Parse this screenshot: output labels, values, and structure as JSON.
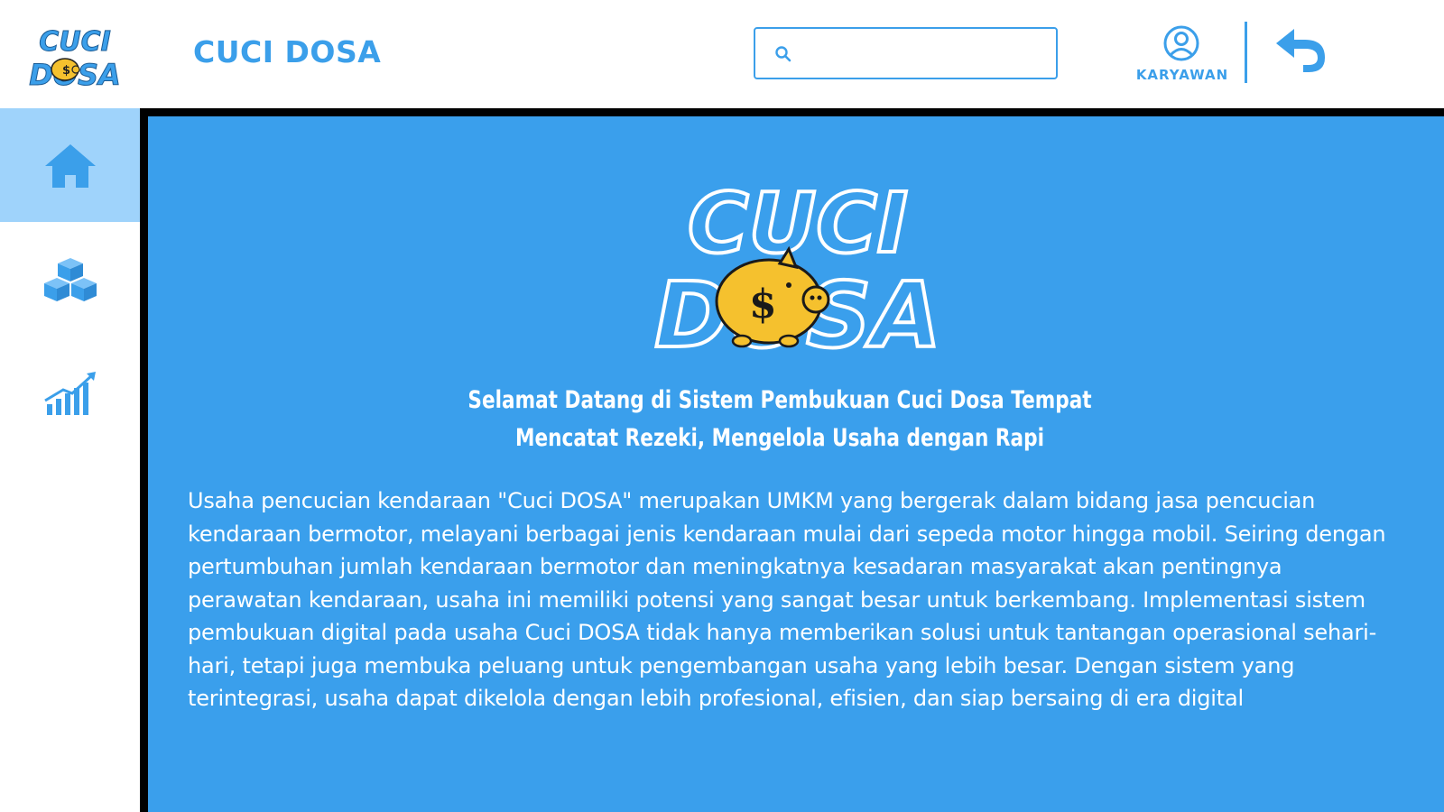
{
  "header": {
    "logo_text": [
      "CUCI",
      "DOSA"
    ],
    "app_title": "CUCI DOSA",
    "search": {
      "value": "",
      "placeholder": "",
      "icon": "search-icon"
    },
    "user": {
      "label": "KARYAWAN",
      "icon": "user-circle-icon"
    },
    "back_icon": "undo-arrow-icon"
  },
  "sidebar": {
    "items": [
      {
        "icon": "home-icon",
        "active": true
      },
      {
        "icon": "boxes-icon",
        "active": false
      },
      {
        "icon": "growth-chart-icon",
        "active": false
      }
    ]
  },
  "main": {
    "logo_text": [
      "CUCI",
      "DOSA"
    ],
    "welcome_line1": "Selamat Datang di Sistem Pembukuan Cuci Dosa Tempat",
    "welcome_line2": "Mencatat Rezeki, Mengelola Usaha dengan Rapi",
    "description": "Usaha pencucian kendaraan \"Cuci DOSA\"  merupakan UMKM yang bergerak dalam bidang jasa pencucian kendaraan bermotor, melayani berbagai jenis kendaraan mulai dari sepeda motor hingga mobil. Seiring dengan pertumbuhan jumlah kendaraan bermotor dan meningkatnya kesadaran masyarakat akan pentingnya perawatan kendaraan, usaha ini memiliki potensi yang sangat besar untuk berkembang. Implementasi sistem pembukuan digital pada usaha Cuci DOSA tidak hanya memberikan solusi untuk tantangan operasional sehari-hari, tetapi juga membuka peluang untuk pengembangan usaha yang lebih besar. Dengan sistem yang terintegrasi, usaha dapat dikelola dengan lebih profesional, efisien, dan siap bersaing di era digital"
  },
  "colors": {
    "accent": "#3b9fea",
    "main_bg": "#3a9fec",
    "nav_active": "#9fd3fb",
    "piggy": "#f5c12e"
  }
}
